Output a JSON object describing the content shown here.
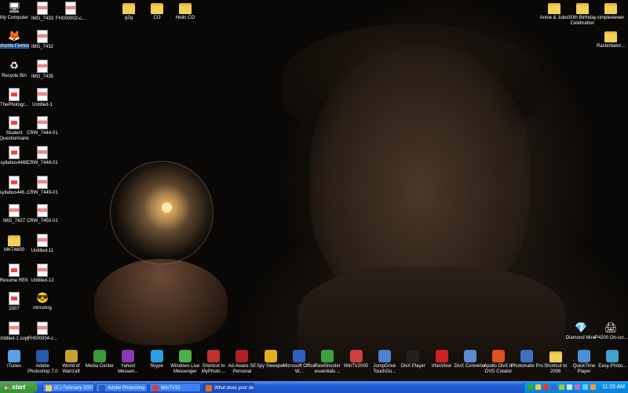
{
  "desktop": {
    "left_column_1": [
      {
        "label": "My Computer",
        "icon": "computer-icon"
      },
      {
        "label": "Mozilla Firefox",
        "icon": "firefox-icon",
        "selected": true
      },
      {
        "label": "Recycle Bin",
        "icon": "recycle-bin-icon"
      },
      {
        "label": "ThePhotogr...",
        "icon": "pdf-icon"
      },
      {
        "label": "Student Questionnaire",
        "icon": "doc-icon"
      },
      {
        "label": "syllabus4469",
        "icon": "doc-icon"
      },
      {
        "label": "syllabus446...",
        "icon": "doc-icon"
      },
      {
        "label": "IMG_7427",
        "icon": "image-icon"
      },
      {
        "label": "MKT4600",
        "icon": "folder-icon"
      },
      {
        "label": "Resume REK",
        "icon": "pdf-icon"
      },
      {
        "label": "2007",
        "icon": "doc-icon"
      },
      {
        "label": "Untitled-1 copy",
        "icon": "image-icon"
      }
    ],
    "left_column_2": [
      {
        "label": "IMG_7433",
        "icon": "image-icon"
      },
      {
        "label": "IMG_7432",
        "icon": "image-icon"
      },
      {
        "label": "IMG_7435",
        "icon": "image-icon"
      },
      {
        "label": "Untitled-1",
        "icon": "image-icon"
      },
      {
        "label": "CRW_7444-01",
        "icon": "image-icon"
      },
      {
        "label": "CRW_7448-01",
        "icon": "image-icon"
      },
      {
        "label": "CRW_7449-01",
        "icon": "image-icon"
      },
      {
        "label": "CRW_7450-01",
        "icon": "image-icon"
      },
      {
        "label": "Untitled-11",
        "icon": "image-icon"
      },
      {
        "label": "Untitled-12",
        "icon": "image-icon"
      },
      {
        "label": "mirroring",
        "icon": "sunglasses-icon"
      },
      {
        "label": "FH000004-c...",
        "icon": "image-icon"
      }
    ],
    "top_row": [
      {
        "label": "FH000002-c...",
        "icon": "image-icon"
      },
      {
        "label": "g2g",
        "icon": "folder-icon"
      },
      {
        "label": "CO",
        "icon": "folder-icon"
      },
      {
        "label": "Helin CO",
        "icon": "folder-icon"
      }
    ],
    "top_right": [
      {
        "label": "Annie & Jules",
        "icon": "folder-icon"
      },
      {
        "label": "50th Birthday Celebration",
        "icon": "folder-icon"
      },
      {
        "label": "simpleviewer",
        "icon": "folder-icon"
      },
      {
        "label": "Rasterbator...",
        "icon": "folder-icon"
      }
    ],
    "right_bottom": [
      {
        "label": "Diamond Mine",
        "icon": "diamond-icon"
      },
      {
        "label": "iP4200 On-scr...",
        "icon": "printer-icon"
      }
    ],
    "bottom_row": [
      {
        "label": "iTunes",
        "icon": "itunes-icon",
        "color": "#5aa0e8"
      },
      {
        "label": "Adobe Photoshop 7.0",
        "icon": "photoshop-icon",
        "color": "#2a5aa8"
      },
      {
        "label": "World of Warcraft",
        "icon": "warcraft-icon",
        "color": "#c8a030"
      },
      {
        "label": "Media Center",
        "icon": "media-center-icon",
        "color": "#3a9a3a"
      },
      {
        "label": "Yahoo! Messen...",
        "icon": "yahoo-icon",
        "color": "#8a3ab0"
      },
      {
        "label": "Skype",
        "icon": "skype-icon",
        "color": "#2aa0e0"
      },
      {
        "label": "Windows Live Messenger",
        "icon": "messenger-icon",
        "color": "#4ab04a"
      },
      {
        "label": "Shortcut to MyPhoto ...",
        "icon": "myphoto-icon",
        "color": "#c03030"
      },
      {
        "label": "Ad-Aware SE Personal",
        "icon": "adaware-icon",
        "color": "#b02020"
      },
      {
        "label": "Spy Sweeper",
        "icon": "spysweeper-icon",
        "color": "#e0b020"
      },
      {
        "label": "Microsoft Office W...",
        "icon": "word-icon",
        "color": "#3060c0"
      },
      {
        "label": "RawShooter essentials ...",
        "icon": "rawshooter-icon",
        "color": "#3aa040"
      },
      {
        "label": "WinTV2000",
        "icon": "wintv-icon",
        "color": "#d04040"
      },
      {
        "label": "JumpDrive TouchGu...",
        "icon": "jumpdrive-icon",
        "color": "#5080d0"
      },
      {
        "label": "DivX Player",
        "icon": "divx-icon",
        "color": "#202020"
      },
      {
        "label": "IrfanView",
        "icon": "irfanview-icon",
        "color": "#d02020"
      },
      {
        "label": "DivX Converter",
        "icon": "divx-converter-icon",
        "color": "#5a8ad0"
      },
      {
        "label": "Apollo DivX to DVD Creator",
        "icon": "apollo-icon",
        "color": "#e05020"
      },
      {
        "label": "Photomatix Pro",
        "icon": "photomatix-icon",
        "color": "#4070c0"
      },
      {
        "label": "Shortcut to 2006",
        "icon": "folder-icon",
        "color": "#f2cf5a"
      },
      {
        "label": "QuickTime Player",
        "icon": "quicktime-icon",
        "color": "#4a90d8"
      },
      {
        "label": "Easy-Photo...",
        "icon": "easyphoto-icon",
        "color": "#40a0d0"
      }
    ]
  },
  "taskbar": {
    "start_label": "start",
    "tasks": [
      {
        "label": "(E:) February 2007",
        "icon": "folder-icon",
        "color": "#f2cf5a"
      },
      {
        "label": "Adobe Photoshop",
        "icon": "photoshop-icon",
        "color": "#2a5aa8"
      },
      {
        "label": "WinTV32",
        "icon": "wintv-icon",
        "color": "#d04040"
      },
      {
        "label": "What does your desi...",
        "icon": "firefox-icon",
        "color": "#e07020",
        "active": true
      }
    ],
    "clock": "11:15 AM"
  }
}
